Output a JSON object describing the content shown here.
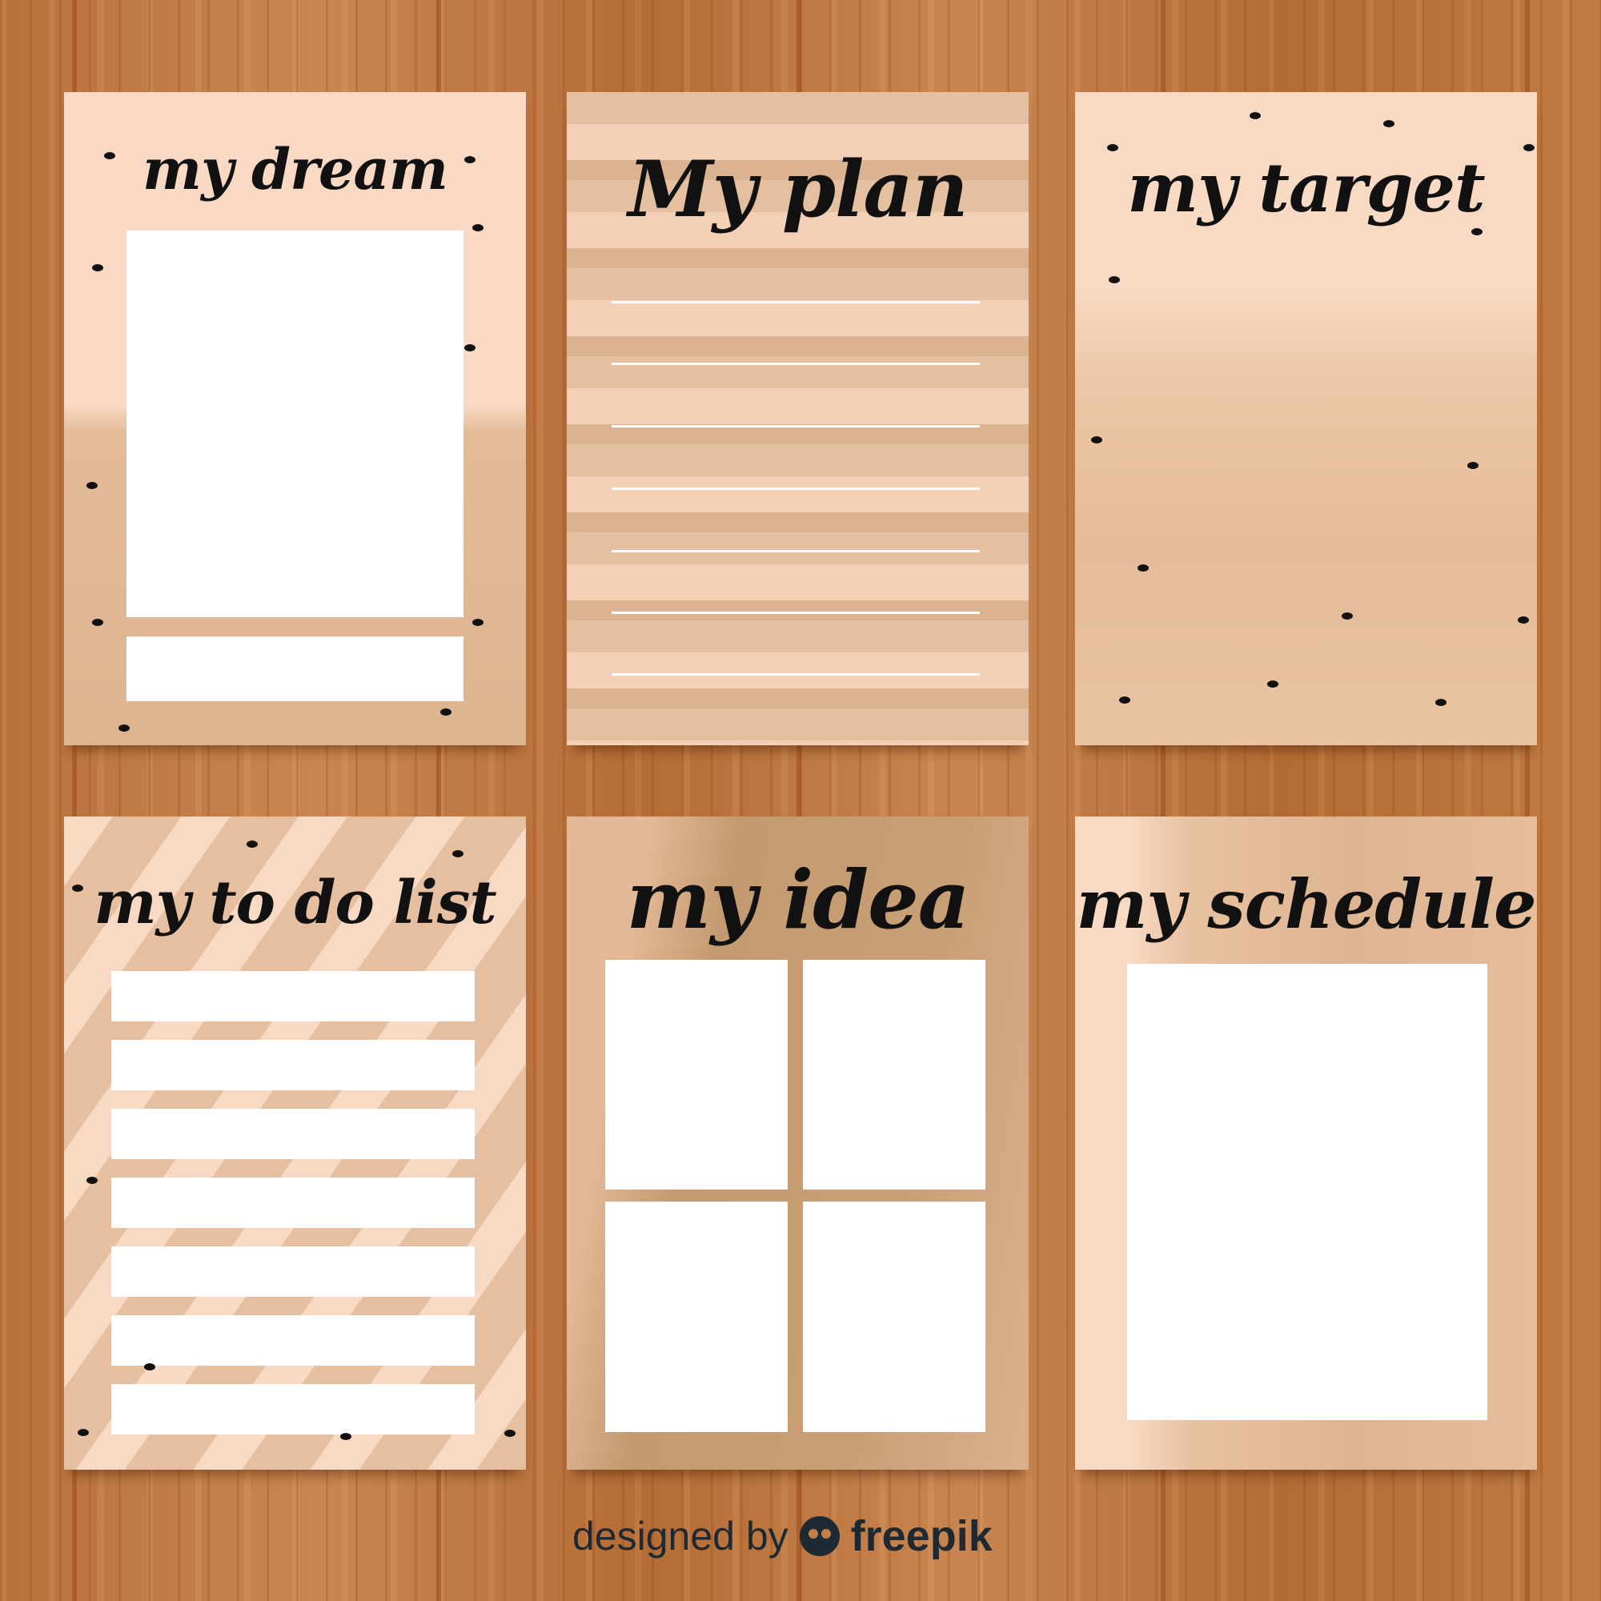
{
  "cards": [
    {
      "title": "my dream"
    },
    {
      "title": "My plan"
    },
    {
      "title": "my target"
    },
    {
      "title": "my to do list"
    },
    {
      "title": "my idea"
    },
    {
      "title": "my schedule"
    }
  ],
  "credit": {
    "prefix": "designed by",
    "brand": "freepik"
  },
  "colors": {
    "card_light": "#f8d9c2",
    "card_mid": "#e2b896",
    "card_dark": "#c49a70",
    "ink": "#111111",
    "wood": "#c07a42"
  }
}
